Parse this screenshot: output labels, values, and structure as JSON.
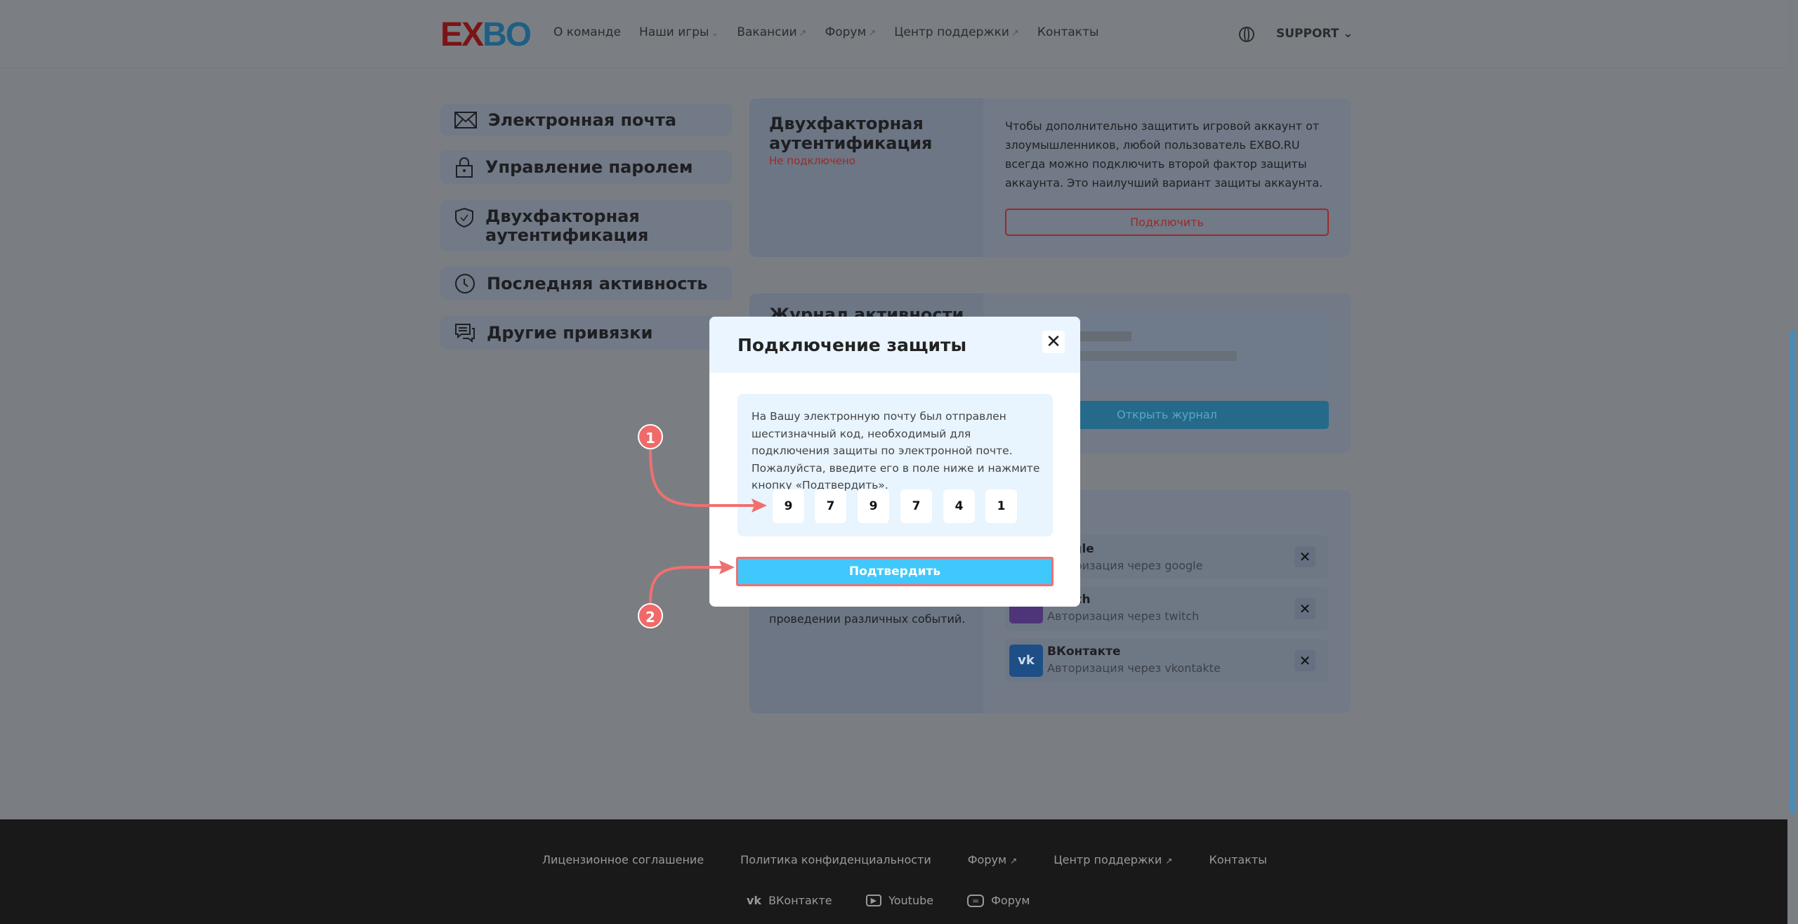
{
  "header": {
    "logo": "EXBO",
    "nav": [
      {
        "label": "О команде",
        "suffix": ""
      },
      {
        "label": "Наши игры",
        "suffix": "⌄"
      },
      {
        "label": "Вакансии",
        "suffix": "↗"
      },
      {
        "label": "Форум",
        "suffix": "↗"
      },
      {
        "label": "Центр поддержки",
        "suffix": "↗"
      },
      {
        "label": "Контакты",
        "suffix": ""
      }
    ],
    "support": "SUPPORT"
  },
  "sidebar": {
    "items": [
      {
        "label": "Электронная почта",
        "icon": "mail-icon"
      },
      {
        "label": "Управление паролем",
        "icon": "lock-icon"
      },
      {
        "label": "Двухфакторная аутентификация",
        "icon": "shield-icon"
      },
      {
        "label": "Последняя активность",
        "icon": "clock-icon"
      },
      {
        "label": "Другие привязки",
        "icon": "chat-icon"
      }
    ]
  },
  "twofa": {
    "title": "Двухфакторная аутентификация",
    "status": "Не подключено",
    "description": "Чтобы дополнительно защитить игровой аккаунт от злоумышленников, любой пользователь EXBO.RU всегда можно подключить второй фактор защиты аккаунта. Это наилучший вариант защиты аккаунта.",
    "button": "Подключить"
  },
  "activity": {
    "title": "Журнал активности",
    "button": "Открыть журнал"
  },
  "bindings": {
    "desc_tail": "проведении различных событий.",
    "items": [
      {
        "name": "Google",
        "sub": "Авторизация через google"
      },
      {
        "name": "Twitch",
        "sub": "Авторизация через twitch"
      },
      {
        "name": "ВКонтакте",
        "sub": "Авторизация через vkontakte"
      }
    ]
  },
  "modal": {
    "title": "Подключение защиты",
    "close": "✕",
    "text": "На Вашу электронную почту был отправлен шестизначный код, необходимый для подключения защиты по электронной почте. Пожалуйста, введите его в поле ниже и нажмите кнопку «Подтвердить».",
    "code": [
      "9",
      "7",
      "9",
      "7",
      "4",
      "1"
    ],
    "confirm": "Подтвердить"
  },
  "annotations": [
    "1",
    "2"
  ],
  "footer": {
    "links": [
      {
        "label": "Лицензионное соглашение",
        "suffix": ""
      },
      {
        "label": "Политика конфиденциальности",
        "suffix": ""
      },
      {
        "label": "Форум",
        "suffix": "↗"
      },
      {
        "label": "Центр поддержки",
        "suffix": "↗"
      },
      {
        "label": "Контакты",
        "suffix": ""
      }
    ],
    "social": [
      "ВКонтакте",
      "Youtube",
      "Форум"
    ]
  },
  "colors": {
    "accent": "#40c8fc",
    "danger": "#f07070",
    "footer_bg": "#1a1919"
  }
}
